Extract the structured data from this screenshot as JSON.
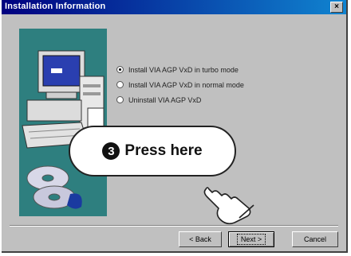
{
  "window": {
    "title": "Installation Information",
    "close_glyph": "×"
  },
  "options": [
    {
      "label": "Install VIA AGP VxD in turbo mode",
      "checked": true
    },
    {
      "label": "Install VIA AGP VxD in normal mode",
      "checked": false
    },
    {
      "label": "Uninstall VIA AGP VxD",
      "checked": false
    }
  ],
  "buttons": {
    "back": "< Back",
    "next": "Next >",
    "cancel": "Cancel"
  },
  "callout": {
    "number": "3",
    "text": "Press here"
  },
  "icons": {
    "close": "close-icon",
    "hand": "pointing-hand-icon",
    "computer": "computer-icon",
    "disc": "cd-icon"
  },
  "colors": {
    "title_start": "#00007f",
    "title_end": "#1084d0",
    "art_bg": "#2e7f7f",
    "dialog_bg": "#c0c0c0"
  }
}
